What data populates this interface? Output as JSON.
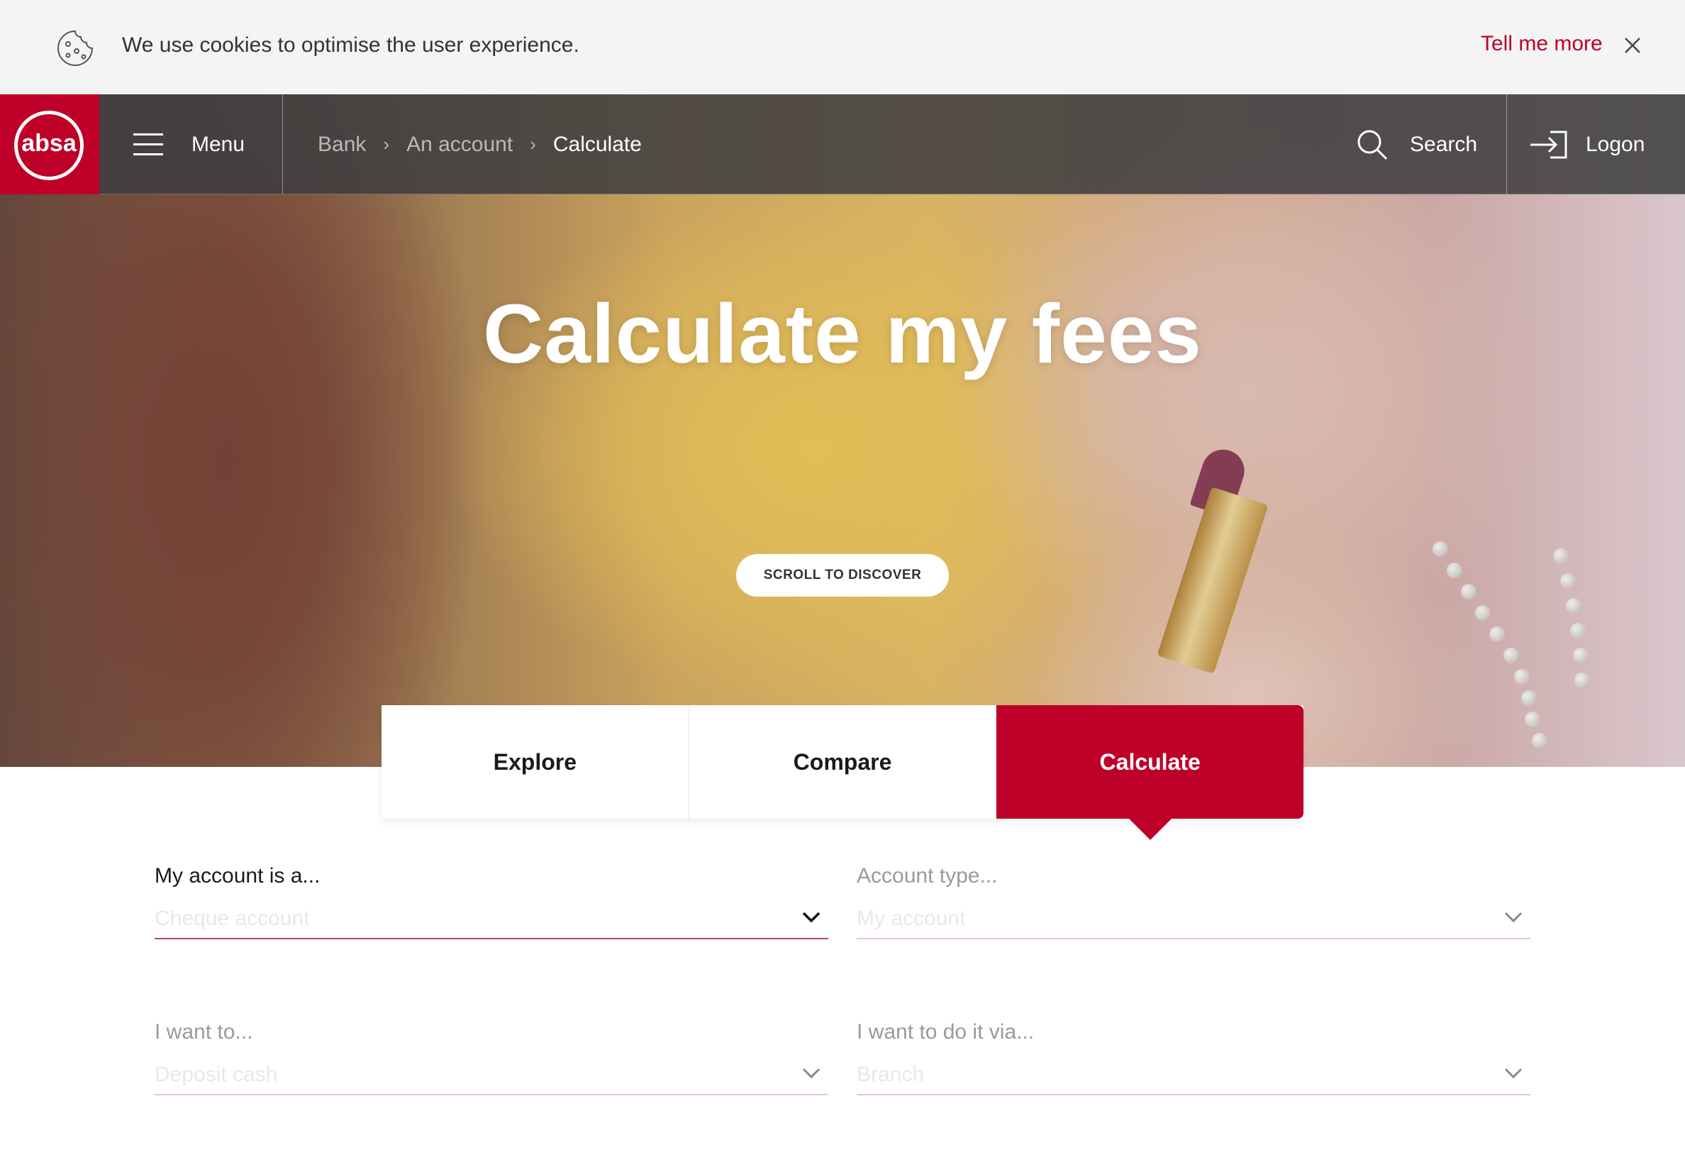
{
  "cookie_bar": {
    "message": "We use cookies to optimise the user experience.",
    "more_link": "Tell me more"
  },
  "header": {
    "logo_text": "absa",
    "menu_label": "Menu",
    "breadcrumb": [
      "Bank",
      "An account",
      "Calculate"
    ],
    "search_label": "Search",
    "logon_label": "Logon"
  },
  "hero": {
    "title": "Calculate my fees",
    "scroll_button": "SCROLL TO DISCOVER"
  },
  "tabs": [
    {
      "label": "Explore",
      "active": false
    },
    {
      "label": "Compare",
      "active": false
    },
    {
      "label": "Calculate",
      "active": true
    }
  ],
  "form": {
    "account_is": {
      "label": "My account is a...",
      "value": "Cheque account"
    },
    "account_type": {
      "label": "Account type...",
      "value": "My account"
    },
    "want_to": {
      "label": "I want to...",
      "value": "Deposit cash"
    },
    "do_it_via": {
      "label": "I want to do it via...",
      "value": "Branch"
    }
  },
  "colors": {
    "brand_red": "#be0028",
    "nav_bar": "#3c3c40",
    "cookie_bg": "#f4f4f4"
  }
}
